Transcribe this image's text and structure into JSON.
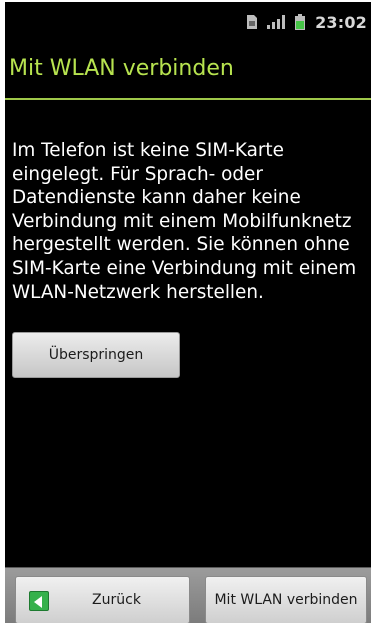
{
  "status_bar": {
    "time": "23:02",
    "icons": [
      "sim-card-icon",
      "signal-strength-icon",
      "battery-icon"
    ],
    "battery_color": "#46c447"
  },
  "header": {
    "title": "Mit WLAN verbinden",
    "accent_color": "#b7e34f"
  },
  "main": {
    "message": "Im Telefon ist keine SIM-Karte\neingelegt. Für Sprach- oder\nDatendienste kann daher keine\nVerbindung mit einem Mobilfunknetz\nhergestellt werden. Sie können ohne\nSIM-Karte eine Verbindung mit einem\nWLAN-Netzwerk herstellen.",
    "skip_label": "Überspringen"
  },
  "footer": {
    "back_label": "Zurück",
    "back_icon": "back-arrow-icon",
    "connect_label": "Mit WLAN verbinden"
  }
}
